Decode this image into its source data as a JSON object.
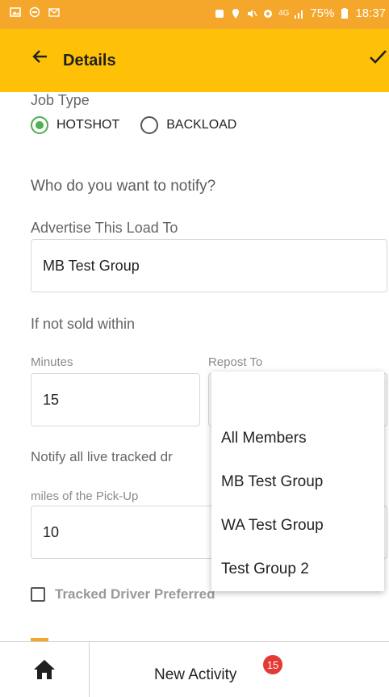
{
  "status_bar": {
    "left_icons": [
      "image-icon",
      "record-icon",
      "gmail-icon"
    ],
    "right_icons": [
      "alarm-icon",
      "location-icon",
      "mute-icon",
      "settings-icon",
      "signal-icon"
    ],
    "network": "4G",
    "battery": "75%",
    "time": "18:37"
  },
  "app_bar": {
    "title": "Details",
    "back_icon": "arrow-left-icon",
    "confirm_icon": "check-icon"
  },
  "form": {
    "job_type_label": "Job Type",
    "job_type_options": [
      {
        "label": "HOTSHOT",
        "selected": true
      },
      {
        "label": "BACKLOAD",
        "selected": false
      }
    ],
    "notify_heading": "Who do you want to notify?",
    "advertise_label": "Advertise This Load To",
    "advertise_value": "MB Test Group",
    "not_sold_label": "If not sold within",
    "minutes_label": "Minutes",
    "minutes_value": "15",
    "repost_label": "Repost To",
    "notify_tracked_label": "Notify all live tracked dr",
    "miles_label": "miles of the Pick-Up",
    "miles_value": "10",
    "tracked_preferred_label": "Tracked Driver Preferred"
  },
  "dropdown": {
    "options": [
      "All Members",
      "MB Test Group",
      "WA Test Group",
      "Test Group 2"
    ]
  },
  "bottom_bar": {
    "home_icon": "home-icon",
    "activity_label": "New Activity",
    "badge_count": "15"
  },
  "colors": {
    "status_bar": "#F4A72A",
    "app_bar": "#FFC107",
    "radio_selected": "#4CAF50",
    "badge": "#E53935"
  }
}
